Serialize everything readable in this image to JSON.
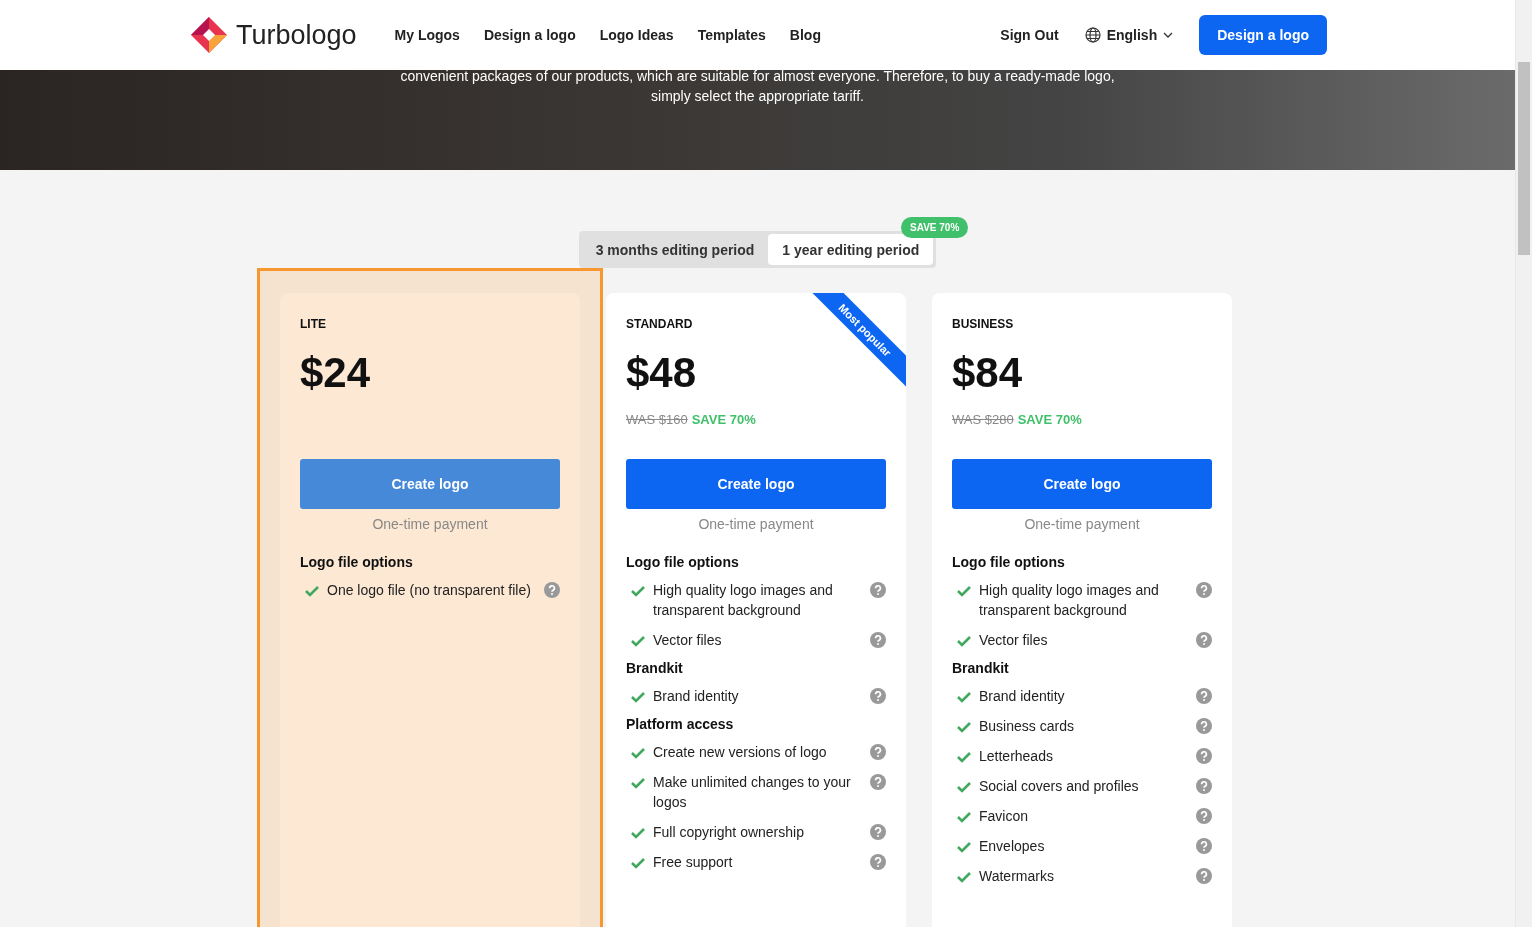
{
  "header": {
    "brand": "Turbologo",
    "nav": [
      {
        "label": "My Logos"
      },
      {
        "label": "Design a logo"
      },
      {
        "label": "Logo Ideas"
      },
      {
        "label": "Templates"
      },
      {
        "label": "Blog"
      }
    ],
    "sign_out": "Sign Out",
    "language": "English",
    "cta": "Design a logo"
  },
  "hero": {
    "text": "convenient packages of our products, which are suitable for almost everyone. Therefore, to buy a ready-made logo, simply select the appropriate tariff."
  },
  "period_tabs": [
    {
      "label": "3 months editing period",
      "selected": false
    },
    {
      "label": "1 year editing period",
      "selected": true,
      "badge": "SAVE 70%"
    }
  ],
  "plans": [
    {
      "name": "LITE",
      "price": "$24",
      "highlighted": true,
      "button": "Create logo",
      "payment": "One-time payment",
      "sections": [
        {
          "heading": "Logo file options",
          "items": [
            "One logo file (no transparent file)"
          ]
        }
      ]
    },
    {
      "name": "STANDARD",
      "price": "$48",
      "was": "WAS $160",
      "save": "SAVE 70%",
      "ribbon": "Most popular",
      "highlighted": false,
      "button": "Create logo",
      "payment": "One-time payment",
      "sections": [
        {
          "heading": "Logo file options",
          "items": [
            "High quality logo images and transparent background",
            "Vector files"
          ]
        },
        {
          "heading": "Brandkit",
          "items": [
            "Brand identity"
          ]
        },
        {
          "heading": "Platform access",
          "items": [
            "Create new versions of logo",
            "Make unlimited changes to your logos",
            "Full copyright ownership",
            "Free support"
          ]
        }
      ]
    },
    {
      "name": "BUSINESS",
      "price": "$84",
      "was": "WAS $280",
      "save": "SAVE 70%",
      "highlighted": false,
      "button": "Create logo",
      "payment": "One-time payment",
      "sections": [
        {
          "heading": "Logo file options",
          "items": [
            "High quality logo images and transparent background",
            "Vector files"
          ]
        },
        {
          "heading": "Brandkit",
          "items": [
            "Brand identity",
            "Business cards",
            "Letterheads",
            "Social covers and profiles",
            "Favicon",
            "Envelopes",
            "Watermarks"
          ]
        }
      ]
    }
  ]
}
